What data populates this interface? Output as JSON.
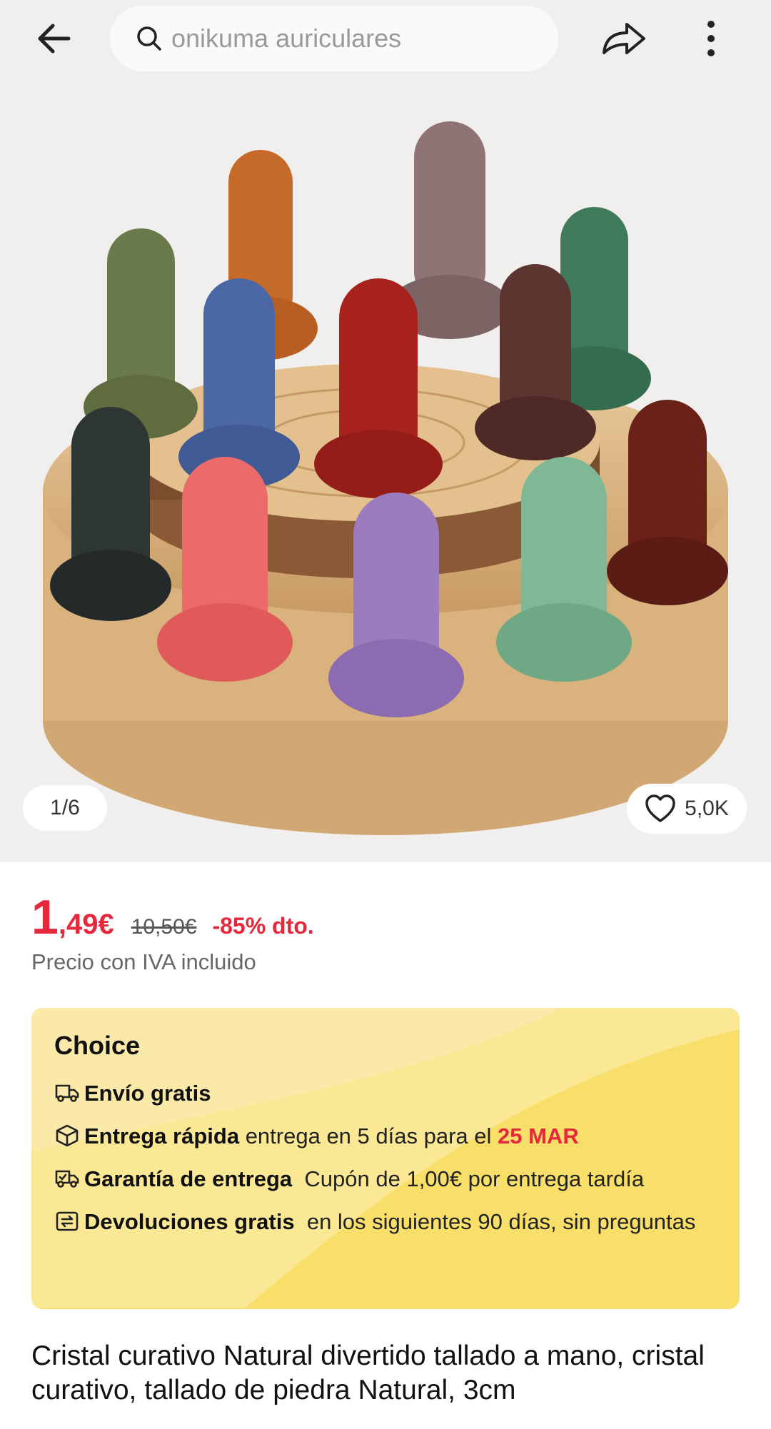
{
  "search": {
    "placeholder": "onikuma auriculares"
  },
  "gallery": {
    "counter": "1/6",
    "likes": "5,0K"
  },
  "price": {
    "integer": "1",
    "decimal": ",49€",
    "old": "10,50€",
    "discount": "-85% dto.",
    "tax_note": "Precio con IVA incluido"
  },
  "choice": {
    "title": "Choice",
    "shipping": "Envío gratis",
    "fast_label": "Entrega rápida",
    "fast_text": "entrega en 5 días para el",
    "fast_date": "25 MAR",
    "guarantee_label": "Garantía de entrega",
    "guarantee_text": "Cupón de 1,00€ por entrega tardía",
    "returns_label": "Devoluciones gratis",
    "returns_text": "en los siguientes 90 días, sin preguntas"
  },
  "product": {
    "title": "Cristal curativo Natural divertido tallado a mano, cristal curativo, tallado de piedra Natural, 3cm"
  },
  "colors": {
    "accent": "#e6283c",
    "choice_bg": "#f8df6a"
  }
}
